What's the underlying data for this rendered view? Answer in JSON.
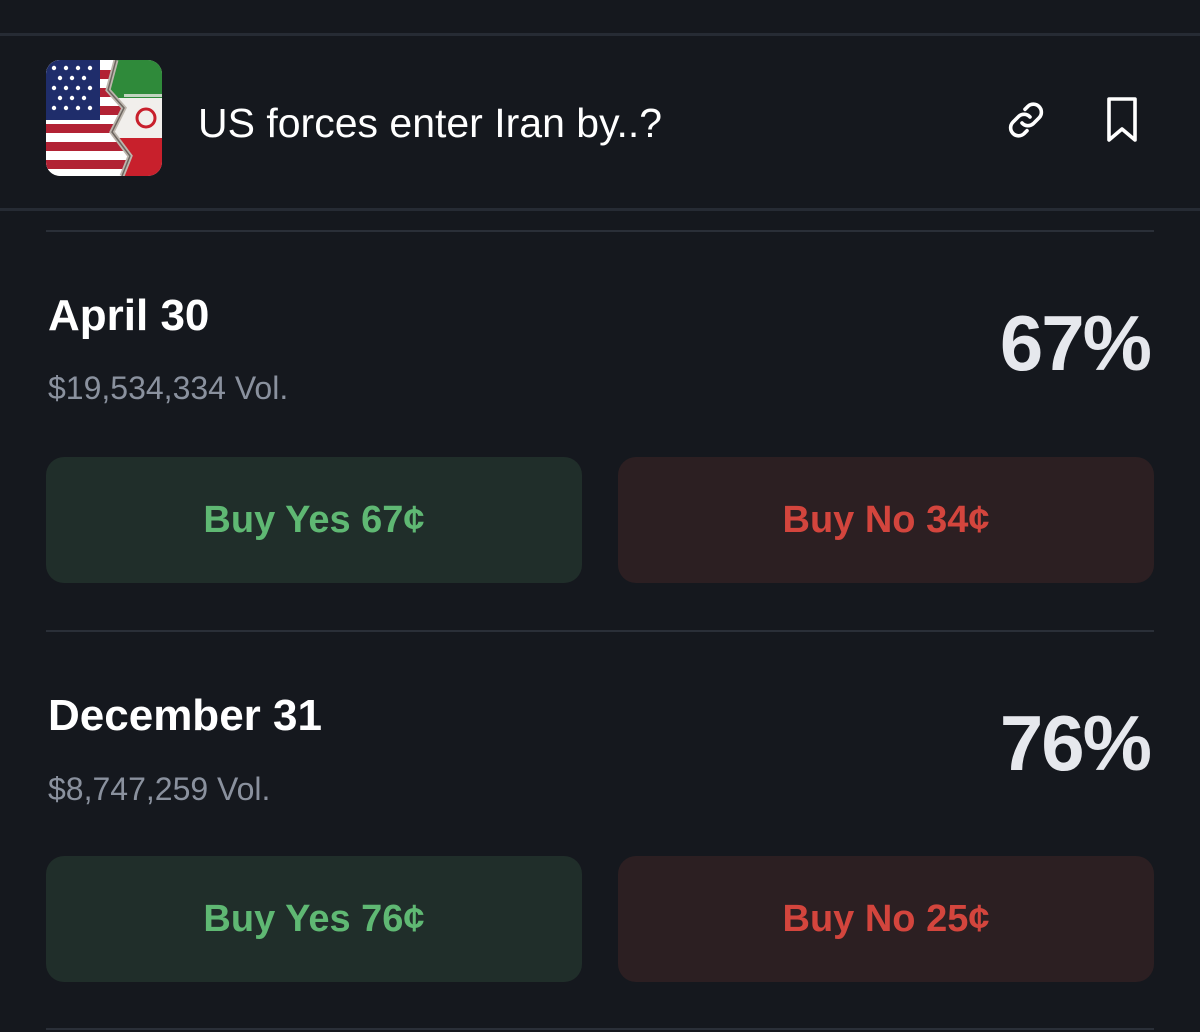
{
  "market": {
    "title": "US forces enter Iran by..?",
    "image_icon": "us-iran-flags-image",
    "link_icon": "link-icon",
    "bookmark_icon": "bookmark-icon"
  },
  "outcomes": [
    {
      "label": "April 30",
      "volume": "$19,534,334 Vol.",
      "chance": "67%",
      "buy_yes": "Buy Yes 67¢",
      "buy_no": "Buy No 34¢"
    },
    {
      "label": "December 31",
      "volume": "$8,747,259 Vol.",
      "chance": "76%",
      "buy_yes": "Buy Yes 76¢",
      "buy_no": "Buy No 25¢"
    }
  ],
  "colors": {
    "background": "#15181e",
    "yes_text": "#5fb873",
    "yes_bg": "#202e2a",
    "no_text": "#d3453d",
    "no_bg": "#2c1f22",
    "volume_text": "#8a919e"
  }
}
